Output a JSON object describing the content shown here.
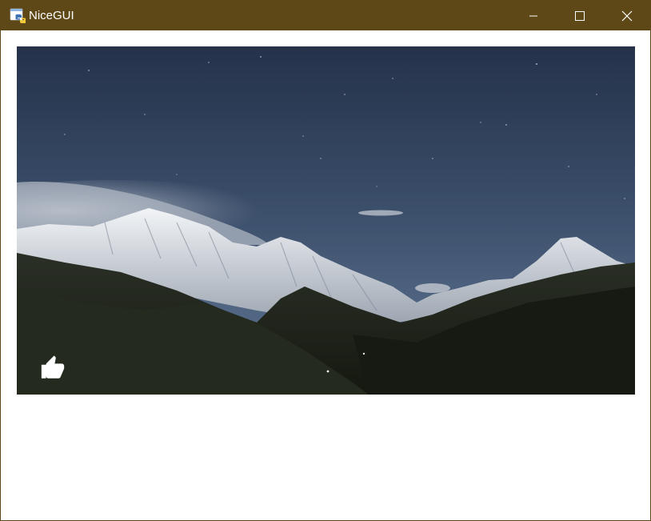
{
  "window": {
    "title": "NiceGUI",
    "icon": "python-app-icon",
    "controls": [
      "minimize-icon",
      "maximize-icon",
      "close-icon"
    ],
    "titlebar_color": "#5e4817"
  },
  "main": {
    "image": {
      "subject": "night-mountain-landscape",
      "overlay_button_icon": "thumb-up-icon"
    }
  }
}
